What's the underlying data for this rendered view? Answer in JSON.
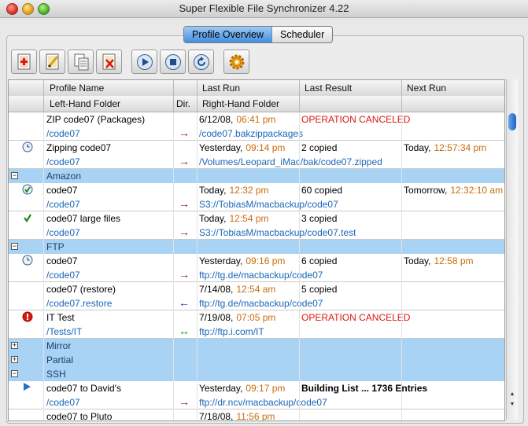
{
  "window": {
    "title": "Super Flexible File Synchronizer 4.22"
  },
  "tabs": [
    {
      "label": "Profile Overview",
      "active": true
    },
    {
      "label": "Scheduler",
      "active": false
    }
  ],
  "toolbar": [
    "new-profile-icon",
    "edit-profile-icon",
    "copy-profile-icon",
    "delete-profile-icon",
    "run-icon",
    "stop-icon",
    "refresh-icon",
    "settings-gear-icon"
  ],
  "columns": {
    "profile_name": "Profile Name",
    "last_run": "Last Run",
    "last_result": "Last Result",
    "next_run": "Next Run",
    "left_folder": "Left-Hand Folder",
    "dir": "Dir.",
    "right_folder": "Right-Hand Folder"
  },
  "rows": [
    {
      "kind": "profile",
      "icon": "",
      "name": "ZIP code07 (Packages)",
      "date": "6/12/08,",
      "time": "06:41 pm",
      "result": "OPERATION CANCELED",
      "result_red": true,
      "next": "",
      "next_time": "",
      "left": "/code07",
      "dir": "→",
      "dir_color": "#8b1a1a",
      "right": "/code07.bakzippackages"
    },
    {
      "kind": "profile",
      "icon": "clock-icon",
      "name": "Zipping code07",
      "date": "Yesterday,",
      "time": "09:14 pm",
      "result": "2 copied",
      "result_red": false,
      "next": "Today,",
      "next_time": "12:57:34 pm",
      "left": "/code07",
      "dir": "→",
      "dir_color": "#8b1a1a",
      "right": "/Volumes/Leopard_iMac/bak/code07.zipped"
    },
    {
      "kind": "group",
      "label": "Amazon",
      "expanded": true
    },
    {
      "kind": "profile",
      "icon": "check-circle-icon",
      "name": "code07",
      "date": "Today,",
      "time": "12:32 pm",
      "result": "60 copied",
      "result_red": false,
      "next": "Tomorrow,",
      "next_time": "12:32:10 am",
      "left": "/code07",
      "dir": "→",
      "dir_color": "#8b1a1a",
      "right": "S3://TobiasM/macbackup/code07"
    },
    {
      "kind": "profile",
      "icon": "checkmark-icon",
      "name": "code07 large files",
      "date": "Today,",
      "time": "12:54 pm",
      "result": "3 copied",
      "result_red": false,
      "next": "",
      "next_time": "",
      "left": "/code07",
      "dir": "→",
      "dir_color": "#8b1a1a",
      "right": "S3://TobiasM/macbackup/code07.test"
    },
    {
      "kind": "group",
      "label": "FTP",
      "expanded": true
    },
    {
      "kind": "profile",
      "icon": "clock-icon",
      "name": "code07",
      "date": "Yesterday,",
      "time": "09:16 pm",
      "result": "6 copied",
      "result_red": false,
      "next": "Today,",
      "next_time": "12:58 pm",
      "left": "/code07",
      "dir": "→",
      "dir_color": "#8b1a1a",
      "right": "ftp://tg.de/macbackup/code07"
    },
    {
      "kind": "profile",
      "icon": "",
      "name": "code07 (restore)",
      "date": "7/14/08,",
      "time": "12:54 am",
      "result": "5 copied",
      "result_red": false,
      "next": "",
      "next_time": "",
      "left": "/code07.restore",
      "dir": "←",
      "dir_color": "#1a2a8b",
      "right": "ftp://tg.de/macbackup/code07"
    },
    {
      "kind": "profile",
      "icon": "error-icon",
      "name": "IT Test",
      "date": "7/19/08,",
      "time": "07:05 pm",
      "result": "OPERATION CANCELED",
      "result_red": true,
      "next": "",
      "next_time": "",
      "left": "/Tests/IT",
      "dir": "↔",
      "dir_color": "#1a8b1a",
      "right": "ftp://ftp.i.com/IT"
    },
    {
      "kind": "group",
      "label": "Mirror",
      "expanded": false
    },
    {
      "kind": "group",
      "label": "Partial",
      "expanded": false
    },
    {
      "kind": "group",
      "label": "SSH",
      "expanded": true
    },
    {
      "kind": "profile",
      "icon": "play-icon",
      "name": "code07 to David's",
      "date": "Yesterday,",
      "time": "09:17 pm",
      "result": "Building List ... 1736 Entries",
      "result_red": false,
      "result_bold": true,
      "next": "",
      "next_time": "",
      "left": "/code07",
      "dir": "→",
      "dir_color": "#8b1a1a",
      "right": "ftp://dr.ncv/macbackup/code07"
    },
    {
      "kind": "profile",
      "icon": "",
      "name": "code07 to Pluto",
      "date": "7/18/08,",
      "time": "11:56 pm",
      "result": "",
      "result_red": false,
      "next": "",
      "next_time": "",
      "left": "",
      "dir": "",
      "dir_color": "#8b1a1a",
      "right": ""
    }
  ]
}
